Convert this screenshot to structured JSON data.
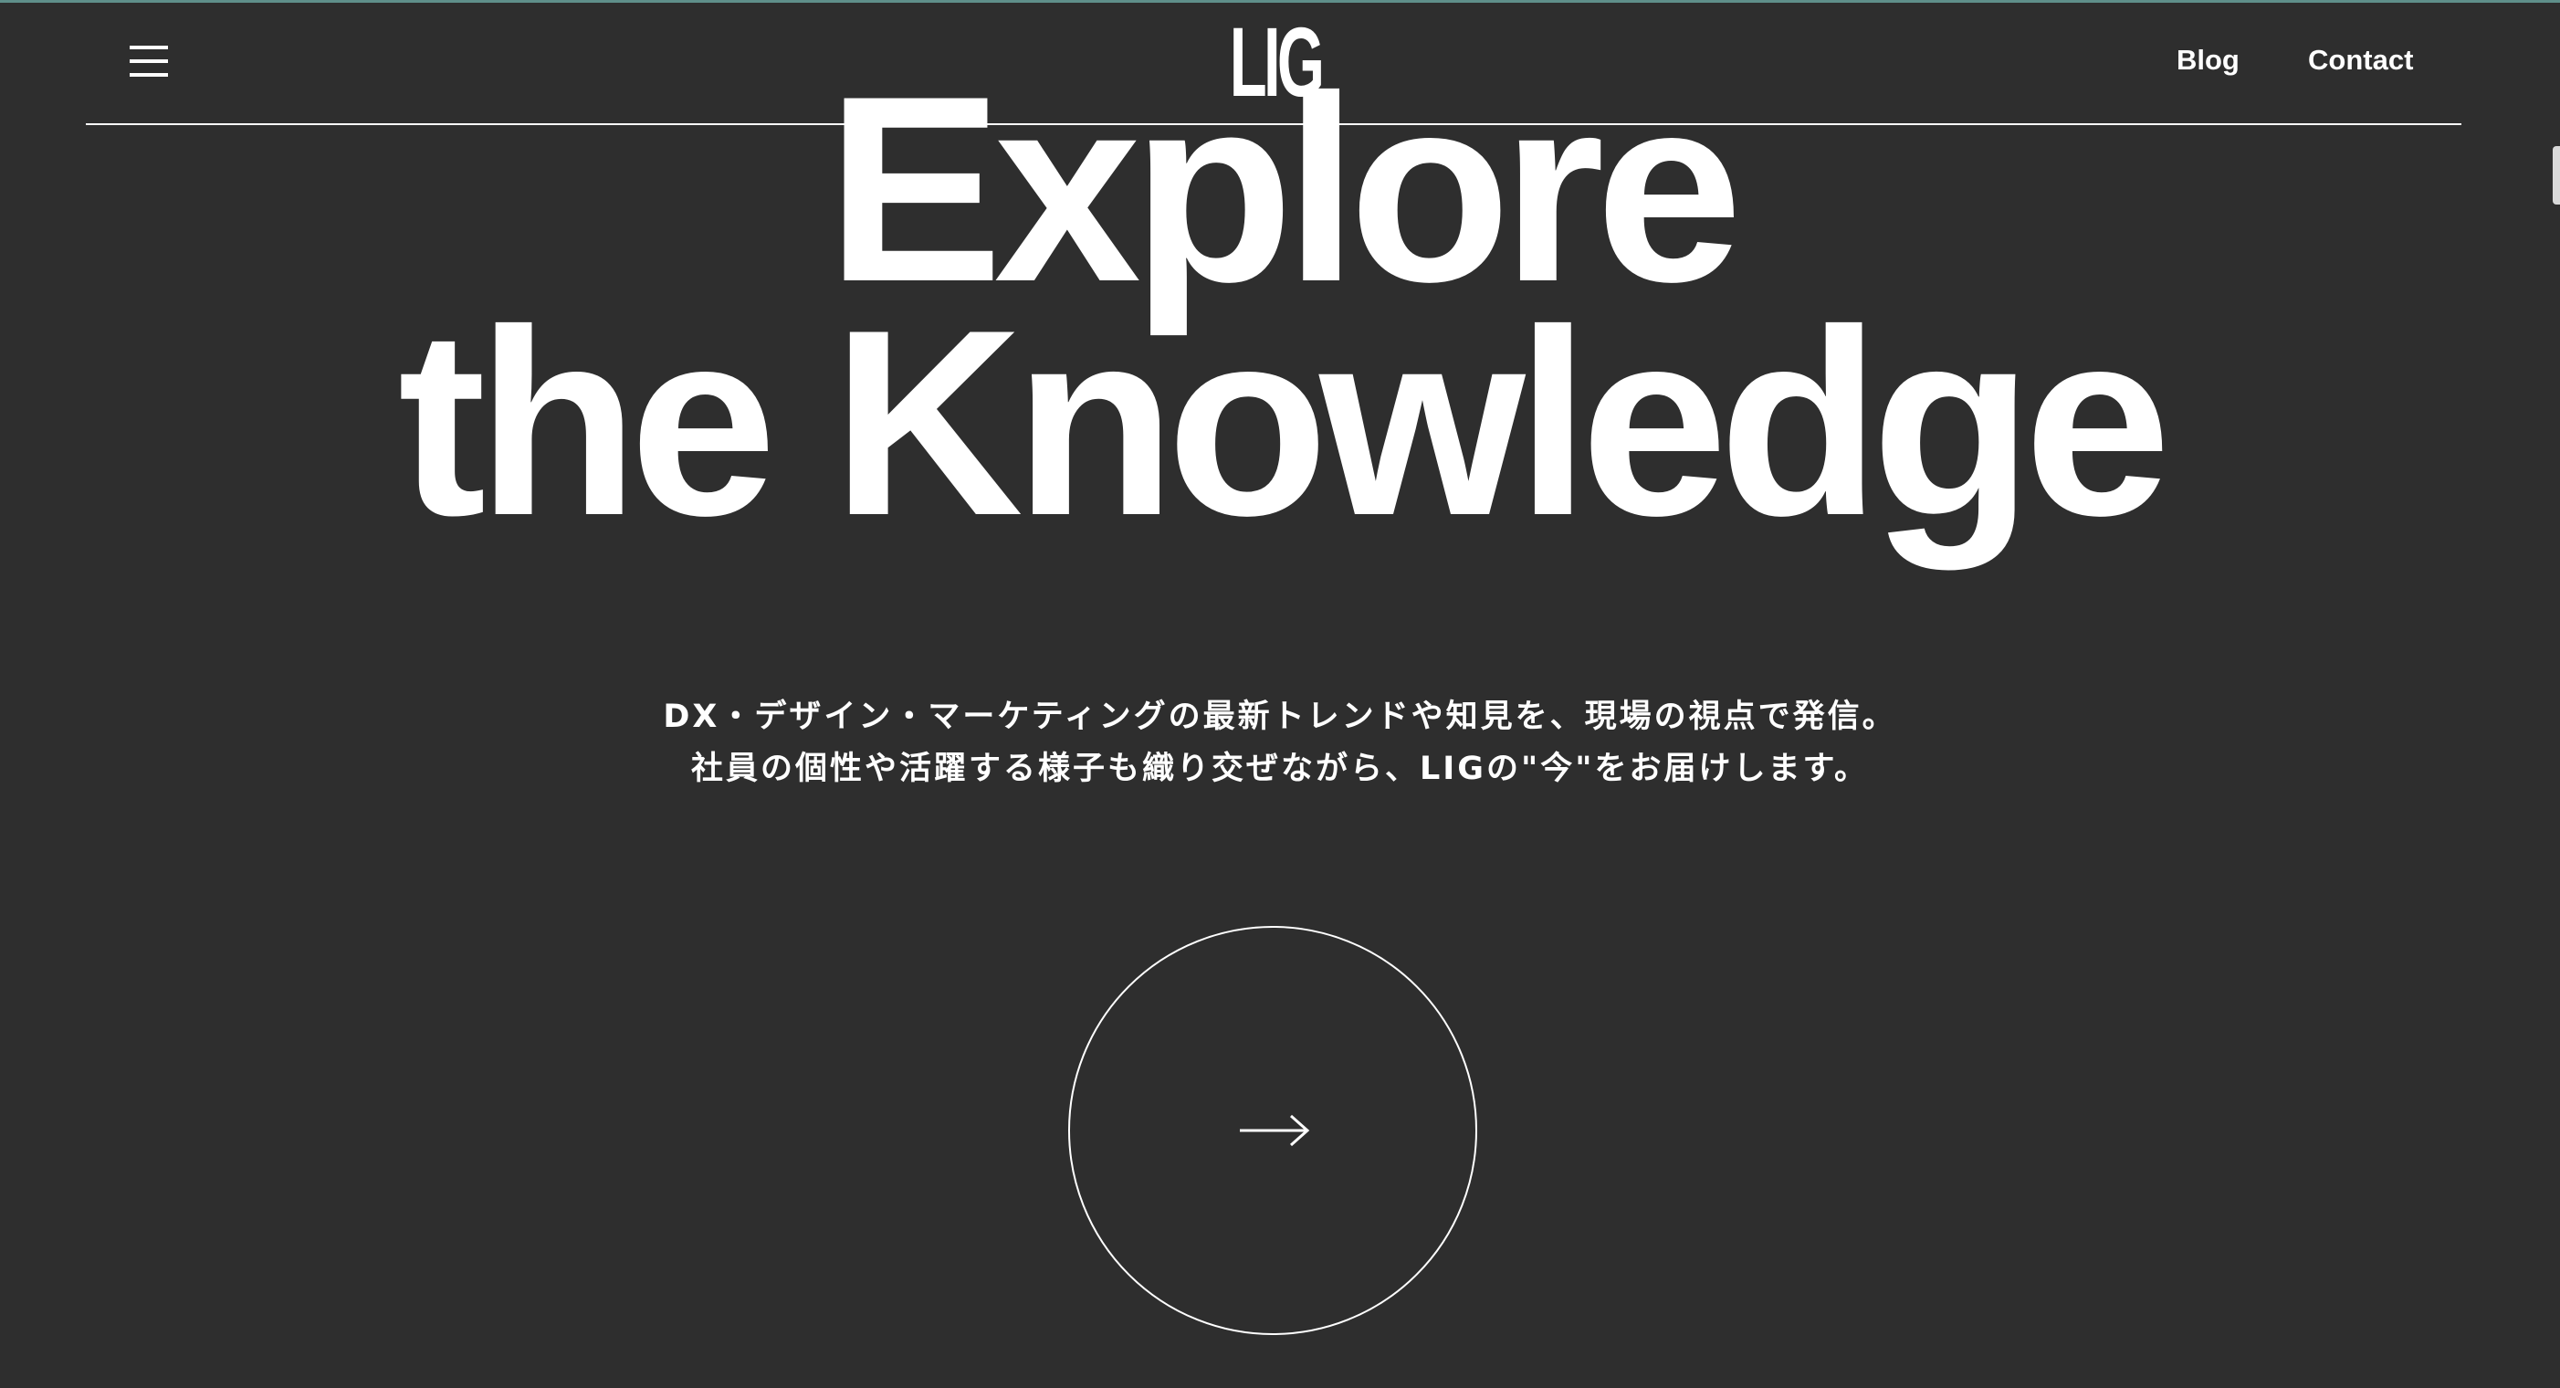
{
  "header": {
    "logo": "LIG",
    "nav": {
      "blog": "Blog",
      "contact": "Contact"
    }
  },
  "hero": {
    "line1": "Explore",
    "line2": "the Knowledge"
  },
  "description": {
    "line1": "DX・デザイン・マーケティングの最新トレンドや知見を、現場の視点で発信。",
    "line2": "社員の個性や活躍する様子も織り交ぜながら、LIGの\"今\"をお届けします。"
  },
  "icons": {
    "menu": "hamburger-icon",
    "cta": "arrow-right-icon"
  },
  "colors": {
    "background": "#2e2e2e",
    "foreground": "#ffffff",
    "top_accent": "#5f8f8a"
  }
}
